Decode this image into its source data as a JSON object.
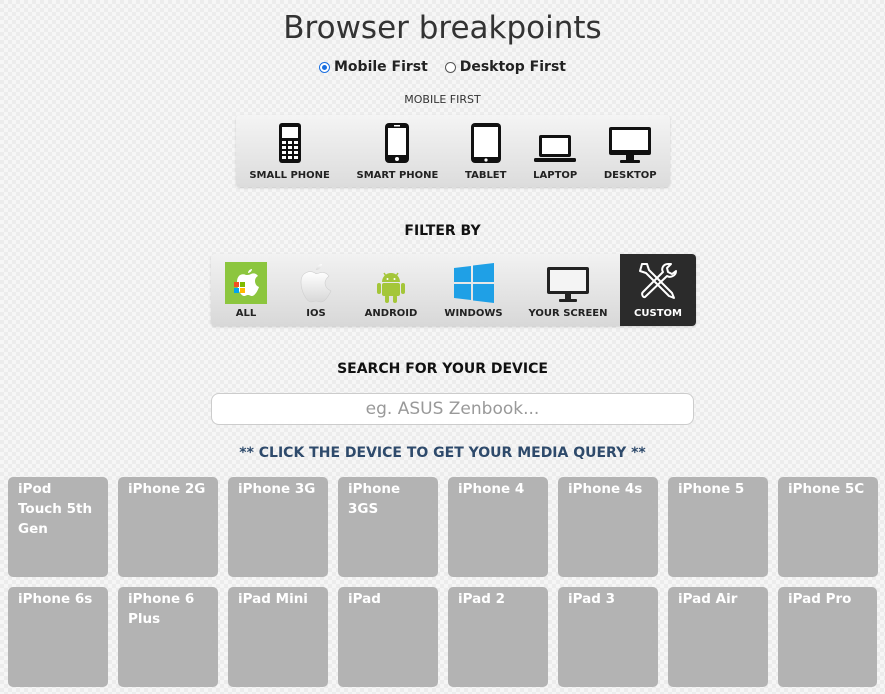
{
  "title": "Browser breakpoints",
  "mode": {
    "options": [
      {
        "label": "Mobile First",
        "selected": true
      },
      {
        "label": "Desktop First",
        "selected": false
      }
    ]
  },
  "subheading": "MOBILE FIRST",
  "breakpoints": [
    {
      "label": "SMALL PHONE",
      "icon": "small-phone-icon"
    },
    {
      "label": "SMART PHONE",
      "icon": "smart-phone-icon"
    },
    {
      "label": "TABLET",
      "icon": "tablet-icon"
    },
    {
      "label": "LAPTOP",
      "icon": "laptop-icon"
    },
    {
      "label": "DESKTOP",
      "icon": "desktop-icon"
    }
  ],
  "filter": {
    "title": "FILTER BY",
    "items": [
      {
        "label": "ALL",
        "icon": "all-icon",
        "active": false
      },
      {
        "label": "IOS",
        "icon": "apple-icon",
        "active": false
      },
      {
        "label": "ANDROID",
        "icon": "android-icon",
        "active": false
      },
      {
        "label": "WINDOWS",
        "icon": "windows-icon",
        "active": false
      },
      {
        "label": "YOUR SCREEN",
        "icon": "monitor-icon",
        "active": false
      },
      {
        "label": "CUSTOM",
        "icon": "tools-icon",
        "active": true
      }
    ]
  },
  "search": {
    "title": "SEARCH FOR YOUR DEVICE",
    "placeholder": "eg. ASUS Zenbook..."
  },
  "hint": "** CLICK THE DEVICE TO GET YOUR MEDIA QUERY **",
  "devices": [
    "iPod Touch 5th Gen",
    "iPhone 2G",
    "iPhone 3G",
    "iPhone 3GS",
    "iPhone 4",
    "iPhone 4s",
    "iPhone 5",
    "iPhone 5C",
    "iPhone 6s",
    "iPhone 6 Plus",
    "iPad Mini",
    "iPad",
    "iPad 2",
    "iPad 3",
    "iPad Air",
    "iPad Pro"
  ],
  "colors": {
    "accent": "#1a6fe0",
    "tile": "#b3b3b3",
    "active_filter": "#2b2b2b",
    "hint": "#2e4a6b"
  }
}
